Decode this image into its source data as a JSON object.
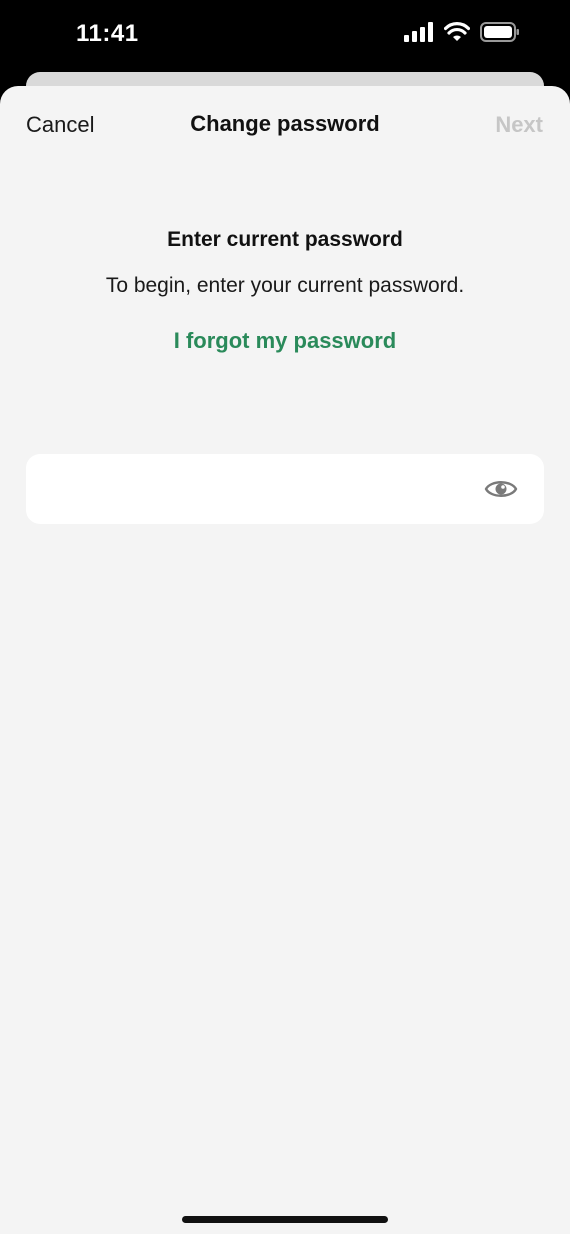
{
  "status_bar": {
    "time": "11:41",
    "icons": [
      "cellular-signal-icon",
      "wifi-icon",
      "battery-icon"
    ]
  },
  "nav": {
    "cancel_label": "Cancel",
    "title": "Change password",
    "next_label": "Next"
  },
  "content": {
    "heading": "Enter current password",
    "subtext": "To begin, enter your current password.",
    "forgot_link": "I forgot my password"
  },
  "password_field": {
    "value": "",
    "placeholder": ""
  },
  "colors": {
    "accent_green": "#2a8a5a",
    "disabled_gray": "#c6c6c6",
    "sheet_background": "#f4f4f4"
  }
}
